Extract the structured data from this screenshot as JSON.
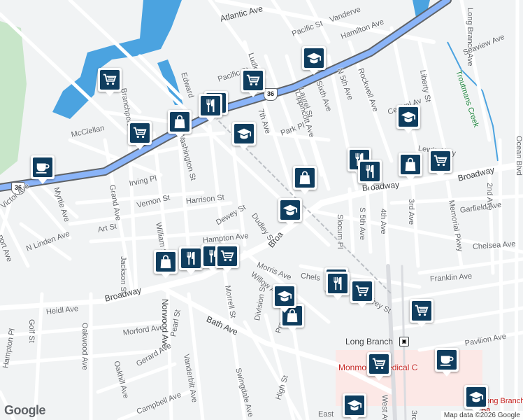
{
  "map": {
    "attribution": "Map data ©2026 Google",
    "logo": "Google",
    "route_shield": "36",
    "colors": {
      "land": "#f1f3f4",
      "water": "#4ba3e0",
      "park": "#c8e6c9",
      "highway": "#8ab4f8",
      "highway_edge": "#5f6368",
      "pin": "#0f3d5e",
      "hospital": "#fce8e6"
    }
  },
  "street_labels": [
    {
      "text": "Atlantic Ave"
    },
    {
      "text": "Pacific St"
    },
    {
      "text": "Vanderve"
    },
    {
      "text": "Hamilton Ave"
    },
    {
      "text": "Long Branch Ave"
    },
    {
      "text": "Seaview Ave"
    },
    {
      "text": "Ludlo"
    },
    {
      "text": "Edward"
    },
    {
      "text": "Pacific St"
    },
    {
      "text": "Sixth Ave"
    },
    {
      "text": "N 5th Ave"
    },
    {
      "text": "Rockwell Ave"
    },
    {
      "text": "Liberty St"
    },
    {
      "text": "Branchport"
    },
    {
      "text": "7th Ave"
    },
    {
      "text": "Laurel St"
    },
    {
      "text": "Lippincott Ave"
    },
    {
      "text": "Central Av"
    },
    {
      "text": "Park Pl"
    },
    {
      "text": "McClellan"
    },
    {
      "text": "Washington St"
    },
    {
      "text": "Lewis Alley"
    },
    {
      "text": "Ocean Blvd"
    },
    {
      "text": "2nd Ave"
    },
    {
      "text": "Broadway"
    },
    {
      "text": "Broadway"
    },
    {
      "text": "Irving Pl"
    },
    {
      "text": "Grand Ave"
    },
    {
      "text": "Vernon St"
    },
    {
      "text": "Harrison St"
    },
    {
      "text": "Myrtle Ave"
    },
    {
      "text": "Victor Ave"
    },
    {
      "text": "Slocum Pl"
    },
    {
      "text": "S 5th Ave"
    },
    {
      "text": "4th Ave"
    },
    {
      "text": "3rd Ave"
    },
    {
      "text": "Memorial Pkwy"
    },
    {
      "text": "Garfield Ave"
    },
    {
      "text": "Art St"
    },
    {
      "text": "Dewey St"
    },
    {
      "text": "Dudley St"
    },
    {
      "text": "Broa"
    },
    {
      "text": "William St"
    },
    {
      "text": "Hampton Ave"
    },
    {
      "text": "N Linden Ave"
    },
    {
      "text": "port Ave"
    },
    {
      "text": "Chelsea Ave"
    },
    {
      "text": "Jackson St"
    },
    {
      "text": "Morris Ave"
    },
    {
      "text": "Chels"
    },
    {
      "text": "Franklin Ave"
    },
    {
      "text": "Willow Av"
    },
    {
      "text": "Broadway"
    },
    {
      "text": "Morrell St"
    },
    {
      "text": "Norwood Ave"
    },
    {
      "text": "ffrey St"
    },
    {
      "text": "Heidl Ave"
    },
    {
      "text": "Golf St"
    },
    {
      "text": "Oakwood Ave"
    },
    {
      "text": "Morford Ave"
    },
    {
      "text": "Bath Ave"
    },
    {
      "text": "Division St"
    },
    {
      "text": "Pearl St"
    },
    {
      "text": "Prospect St"
    },
    {
      "text": "Gerard Ave"
    },
    {
      "text": "Oakhill Ave"
    },
    {
      "text": "Vanderbilt Ave"
    },
    {
      "text": "Pavilion Ave"
    },
    {
      "text": "Swingdale Ave"
    },
    {
      "text": "Campbell Ave"
    },
    {
      "text": "High St"
    },
    {
      "text": "Hampton Pl"
    },
    {
      "text": "West Av"
    },
    {
      "text": "East"
    },
    {
      "text": "3rd"
    }
  ],
  "places": {
    "station": "Long Branch",
    "hospital": "Monmouth Medical C",
    "school_partial": "Long Branch",
    "school_partial2": "Ba",
    "creek": "Troutmans Creek"
  },
  "pins": [
    {
      "icon": "school-icon"
    },
    {
      "icon": "grocery-cart-icon"
    },
    {
      "icon": "grocery-cart-icon"
    },
    {
      "icon": "restaurant-icon"
    },
    {
      "icon": "restaurant-icon"
    },
    {
      "icon": "shopping-bag-icon"
    },
    {
      "icon": "school-icon"
    },
    {
      "icon": "school-icon"
    },
    {
      "icon": "grocery-cart-icon"
    },
    {
      "icon": "coffee-cup-icon"
    },
    {
      "icon": "shopping-bag-icon"
    },
    {
      "icon": "school-icon"
    },
    {
      "icon": "restaurant-icon"
    },
    {
      "icon": "restaurant-icon"
    },
    {
      "icon": "shopping-bag-icon"
    },
    {
      "icon": "grocery-cart-icon"
    },
    {
      "icon": "shopping-bag-icon"
    },
    {
      "icon": "restaurant-icon"
    },
    {
      "icon": "restaurant-icon"
    },
    {
      "icon": "grocery-cart-icon"
    },
    {
      "icon": "school-icon"
    },
    {
      "icon": "shopping-bag-icon"
    },
    {
      "icon": "restaurant-icon"
    },
    {
      "icon": "school-icon"
    },
    {
      "icon": "grocery-cart-icon"
    },
    {
      "icon": "grocery-cart-icon"
    },
    {
      "icon": "grocery-cart-icon"
    },
    {
      "icon": "coffee-cup-icon"
    },
    {
      "icon": "school-icon"
    },
    {
      "icon": "school-icon"
    }
  ]
}
